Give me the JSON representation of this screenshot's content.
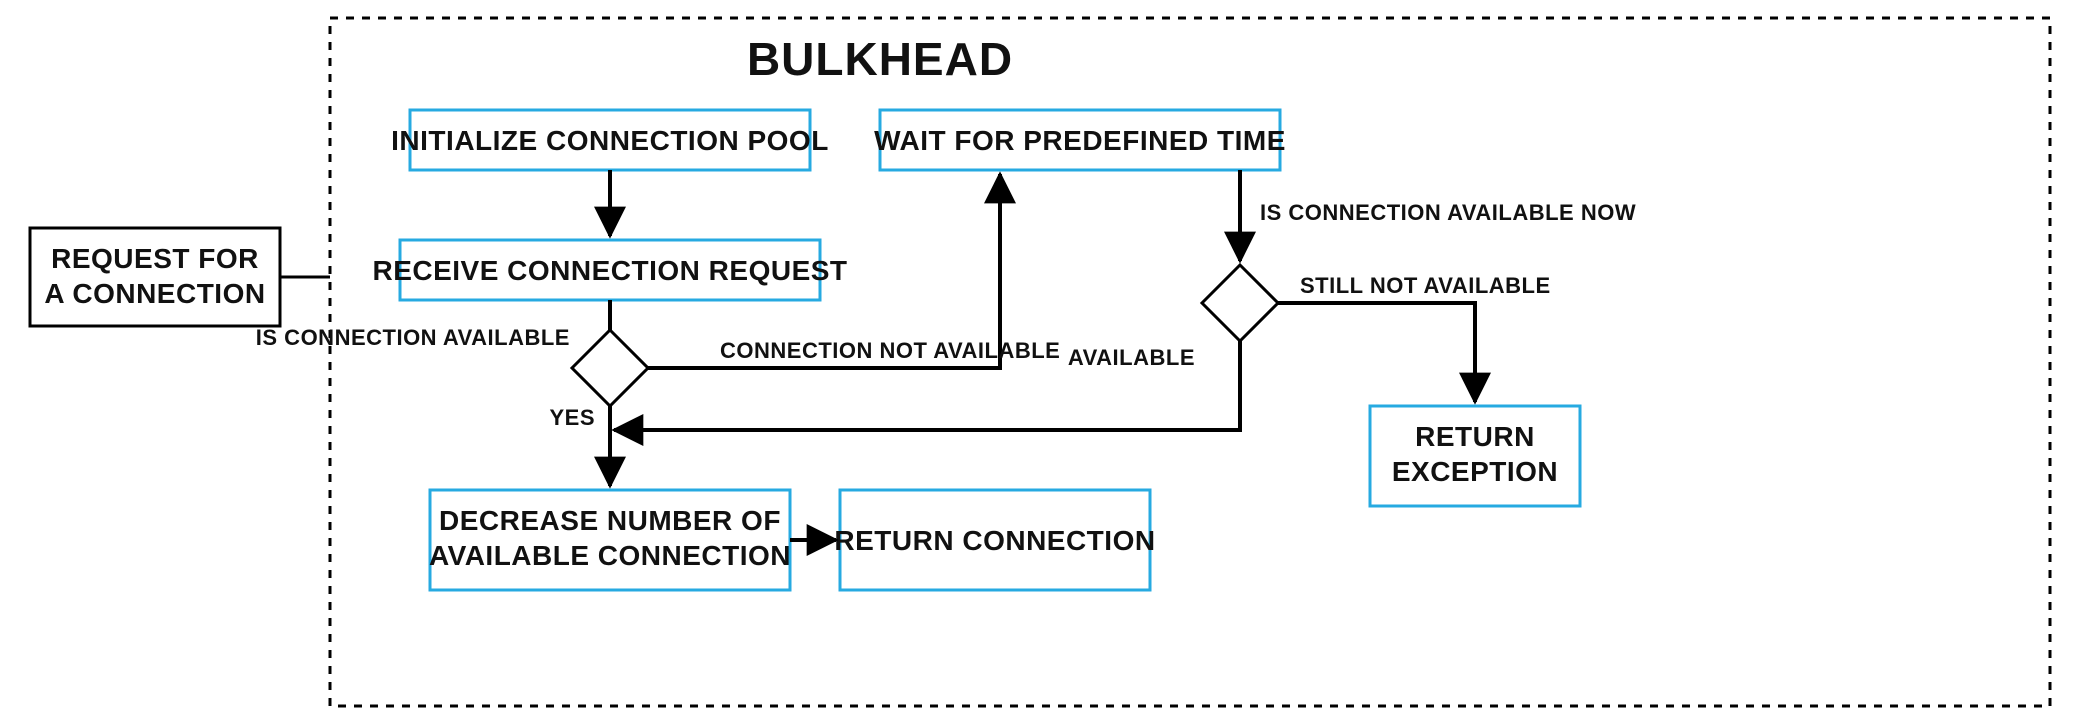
{
  "title": "BULKHEAD",
  "nodes": {
    "request": {
      "line1": "REQUEST FOR",
      "line2": "A CONNECTION"
    },
    "init": {
      "line1": "INITIALIZE CONNECTION POOL"
    },
    "receive": {
      "line1": "RECEIVE CONNECTION REQUEST"
    },
    "wait": {
      "line1": "WAIT FOR PREDEFINED TIME"
    },
    "decrease": {
      "line1": "DECREASE NUMBER OF",
      "line2": "AVAILABLE CONNECTION"
    },
    "returnConn": {
      "line1": "RETURN CONNECTION"
    },
    "returnExc": {
      "line1": "RETURN",
      "line2": "EXCEPTION"
    }
  },
  "edges": {
    "isConnAvail": "IS CONNECTION AVAILABLE",
    "yes": "YES",
    "connNotAvail": "CONNECTION NOT AVAILABLE",
    "isConnAvailNow": "IS CONNECTION AVAILABLE NOW",
    "stillNotAvail": "STILL NOT AVAILABLE",
    "available": "AVAILABLE"
  }
}
